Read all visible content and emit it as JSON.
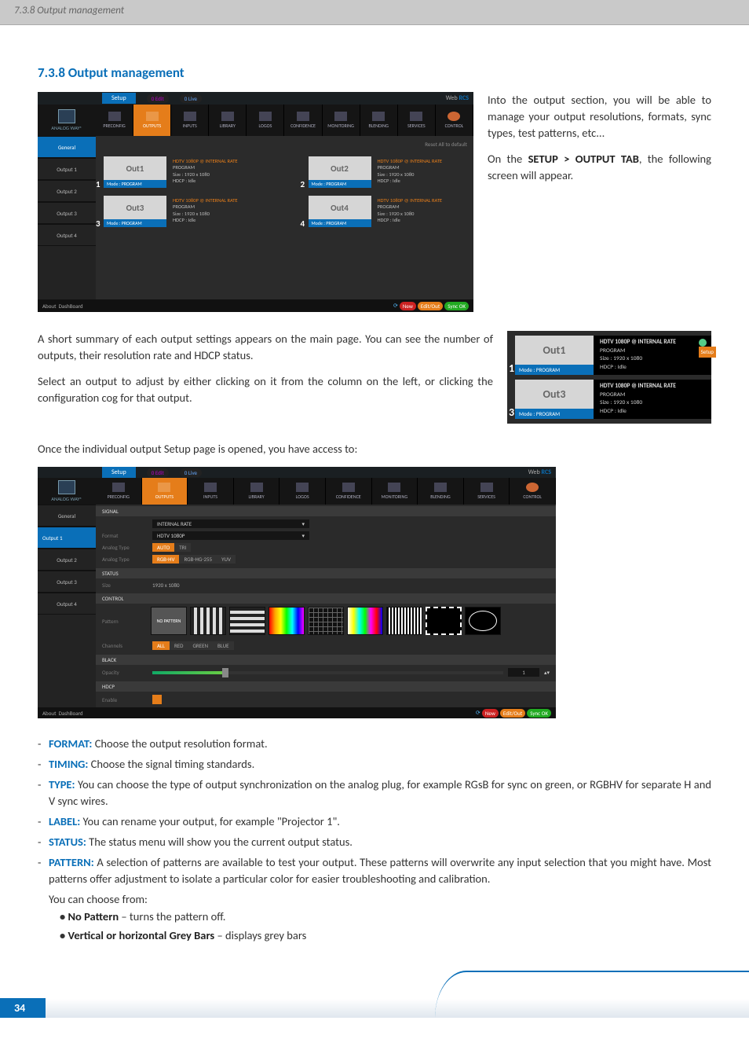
{
  "page_header": "7.3.8 Output management",
  "section_title": "7.3.8 Output management",
  "page_number": "34",
  "intro": {
    "p1": "Into the output section, you will be able to manage your output resolutions, formats, sync types, test patterns, etc...",
    "p2_pre": "On the ",
    "p2_bold": "SETUP > OUTPUT TAB",
    "p2_post": ", the following screen will appear."
  },
  "mid": {
    "p1": "A short summary of each output settings appears on the main page. You can see the number of outputs, their resolution rate and HDCP status.",
    "p2": "Select an output to adjust by either clicking on it from the column on the left, or clicking the configuration cog for that output."
  },
  "once_open": "Once the individual output Setup page is opened, you have access to:",
  "defs": {
    "format": {
      "label": "FORMAT:",
      "text": " Choose the output resolution format."
    },
    "timing": {
      "label": "TIMING:",
      "text": " Choose the signal timing standards."
    },
    "type": {
      "label": "TYPE:",
      "text": " You can choose the type of output synchronization on the analog plug, for example RGsB for sync on green, or RGBHV for separate H and V sync wires."
    },
    "label": {
      "label": "LABEL:",
      "text": " You can rename your output, for example \"Projector 1\"."
    },
    "status": {
      "label": "STATUS:",
      "text": " The status menu will show you the current output status."
    },
    "pattern": {
      "label": "PATTERN:",
      "text": " A selection of patterns are available to test your output. These patterns will overwrite any input selection that you might have. Most patterns offer adjustment to isolate a particular color for easier troubleshooting and calibration."
    }
  },
  "pattern_tail": {
    "choose": "You can choose from:",
    "opt1_b": "No Pattern",
    "opt1_t": " – turns the pattern off.",
    "opt2_b": "Vertical or horizontal Grey Bars",
    "opt2_t": " – displays grey bars"
  },
  "app": {
    "brand": "ANALOG WAY®",
    "logo_web": "Web ",
    "logo_rcs": "RCS ",
    "setup_tab": "Setup",
    "pill1": "0 Edit",
    "pill2": "0 Live",
    "tabs": [
      "PRECONFIG",
      "OUTPUTS",
      "INPUTS",
      "LIBRARY",
      "LOGOS",
      "CONFIDENCE",
      "MONITORING",
      "BLENDING",
      "SERVICES",
      "CONTROL"
    ],
    "side": [
      "General",
      "Output 1",
      "Output 2",
      "Output 3",
      "Output 4"
    ],
    "reset": "Reset All to default",
    "card_meta_rate": "HDTV 1080P @ INTERNAL RATE",
    "card_meta_prog": "PROGRAM",
    "card_meta_size": "Size : 1920 x 1080",
    "card_meta_hdcp": "HDCP : Idle",
    "cards": [
      {
        "n": "1",
        "name": "Out1",
        "mode": "Mode : PROGRAM"
      },
      {
        "n": "2",
        "name": "Out2",
        "mode": "Mode : PROGRAM"
      },
      {
        "n": "3",
        "name": "Out3",
        "mode": "Mode : PROGRAM"
      },
      {
        "n": "4",
        "name": "Out4",
        "mode": "Mode : PROGRAM"
      }
    ],
    "footer_tabs": [
      "About",
      "DashBoard"
    ],
    "footer_pills": [
      "New",
      "Edit/Out",
      "Sync OK"
    ]
  },
  "closeup": {
    "setup_badge": "Setup",
    "rows": [
      {
        "n": "1",
        "name": "Out1",
        "mode": "Mode : PROGRAM",
        "rate": "HDTV 1080P @ INTERNAL RATE",
        "prog": "PROGRAM",
        "size": "Size : 1920 x 1080",
        "hdcp": "HDCP : Idle"
      },
      {
        "n": "3",
        "name": "Out3",
        "mode": "Mode : PROGRAM",
        "rate": "HDTV 1080P @ INTERNAL RATE",
        "prog": "PROGRAM",
        "size": "Size : 1920 x 1080",
        "hdcp": "HDCP : Idle"
      }
    ]
  },
  "detail": {
    "sections": {
      "signal": "SIGNAL",
      "status": "STATUS",
      "control": "CONTROL",
      "black": "BLACK",
      "hdcp": "HDCP"
    },
    "rate_lbl": "",
    "rate_val": "INTERNAL RATE",
    "format_lbl": "Format",
    "format_val": "HDTV 1080P",
    "trilevel_lbl": "Analog Type",
    "tri_auto": "AUTO",
    "tri_trilvl": "TRI",
    "anatype_lbl": "Analog Type",
    "ana_rgbhv": "RGB-HV",
    "ana_rgb255": "RGB-HG-255",
    "ana_yuv": "YUV",
    "status_size_lbl": "Size",
    "status_size_val": "1920 x 1080",
    "pattern_lbl": "Pattern",
    "no_pattern": "NO PATTERN",
    "channels_lbl": "Channels",
    "ch_all": "ALL",
    "ch_red": "RED",
    "ch_green": "GREEN",
    "ch_blue": "BLUE",
    "opacity_lbl": "Opacity",
    "opacity_val": "1",
    "enable_lbl": "Enable"
  }
}
